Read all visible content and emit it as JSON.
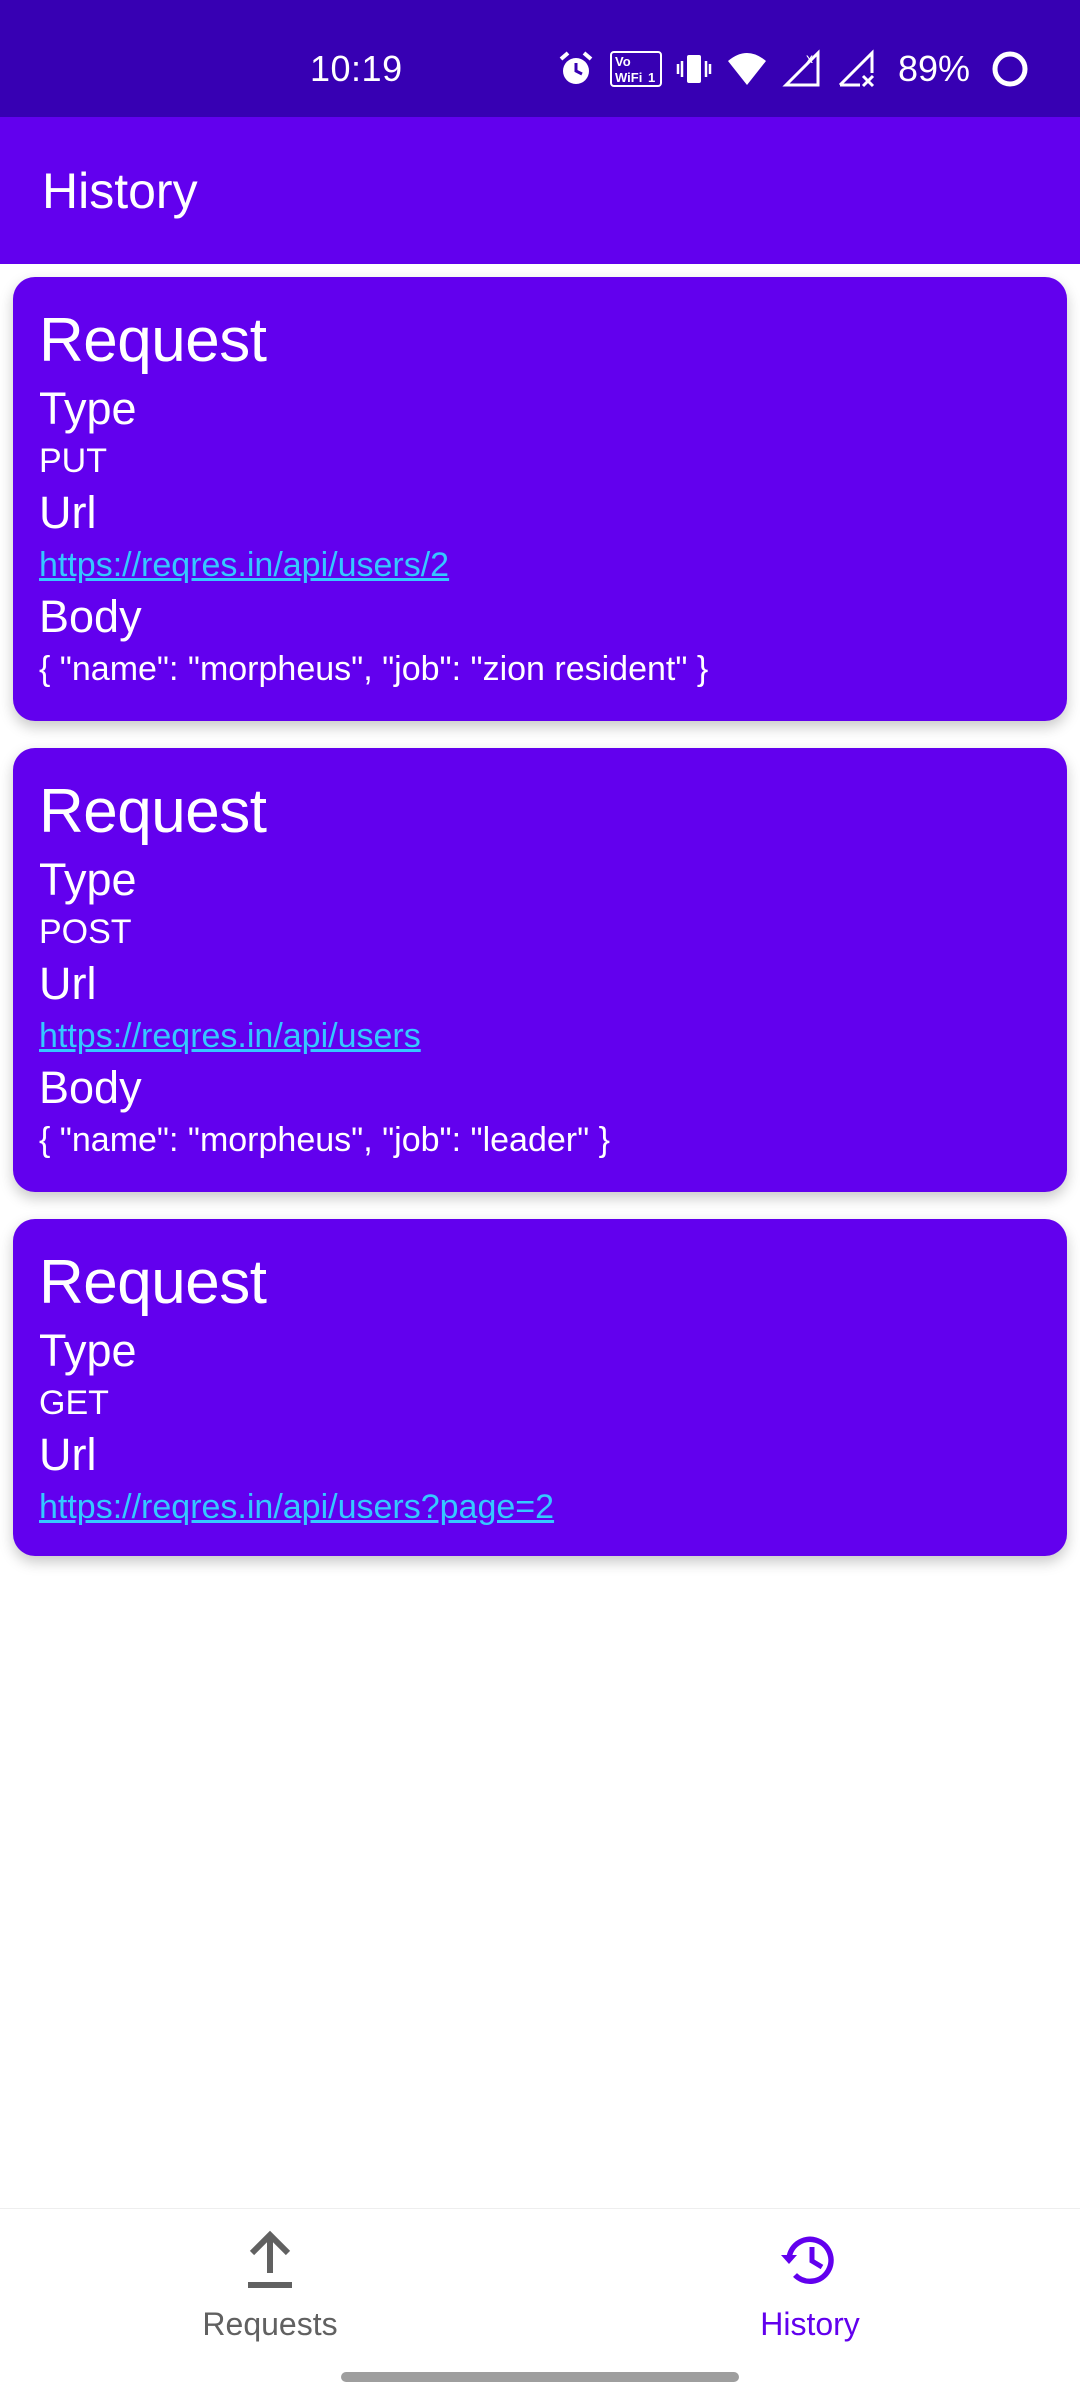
{
  "status_bar": {
    "time": "10:19",
    "battery": "89%",
    "icons": [
      "alarm-icon",
      "vowifi-icon",
      "vibrate-icon",
      "wifi-icon",
      "signal-icon",
      "signal-no-service-icon",
      "battery-icon"
    ],
    "vowifi_label": "Vo WiFi 1"
  },
  "app_bar": {
    "title": "History"
  },
  "colors": {
    "primary": "#6200ee",
    "primary_dark": "#3700b3",
    "link": "#35c8ff",
    "nav_inactive": "#616161"
  },
  "cards": [
    {
      "heading": "Request",
      "type_label": "Type",
      "type_value": "PUT",
      "url_label": "Url",
      "url": "https://reqres.in/api/users/2",
      "body_label": "Body",
      "body": "{ \"name\": \"morpheus\", \"job\": \"zion resident\" }"
    },
    {
      "heading": "Request",
      "type_label": "Type",
      "type_value": "POST",
      "url_label": "Url",
      "url": "https://reqres.in/api/users",
      "body_label": "Body",
      "body": "{ \"name\": \"morpheus\", \"job\": \"leader\" }"
    },
    {
      "heading": "Request",
      "type_label": "Type",
      "type_value": "GET",
      "url_label": "Url",
      "url": "https://reqres.in/api/users?page=2"
    }
  ],
  "bottom_nav": {
    "items": [
      {
        "label": "Requests",
        "icon": "upload-icon",
        "active": false
      },
      {
        "label": "History",
        "icon": "history-icon",
        "active": true
      }
    ]
  }
}
